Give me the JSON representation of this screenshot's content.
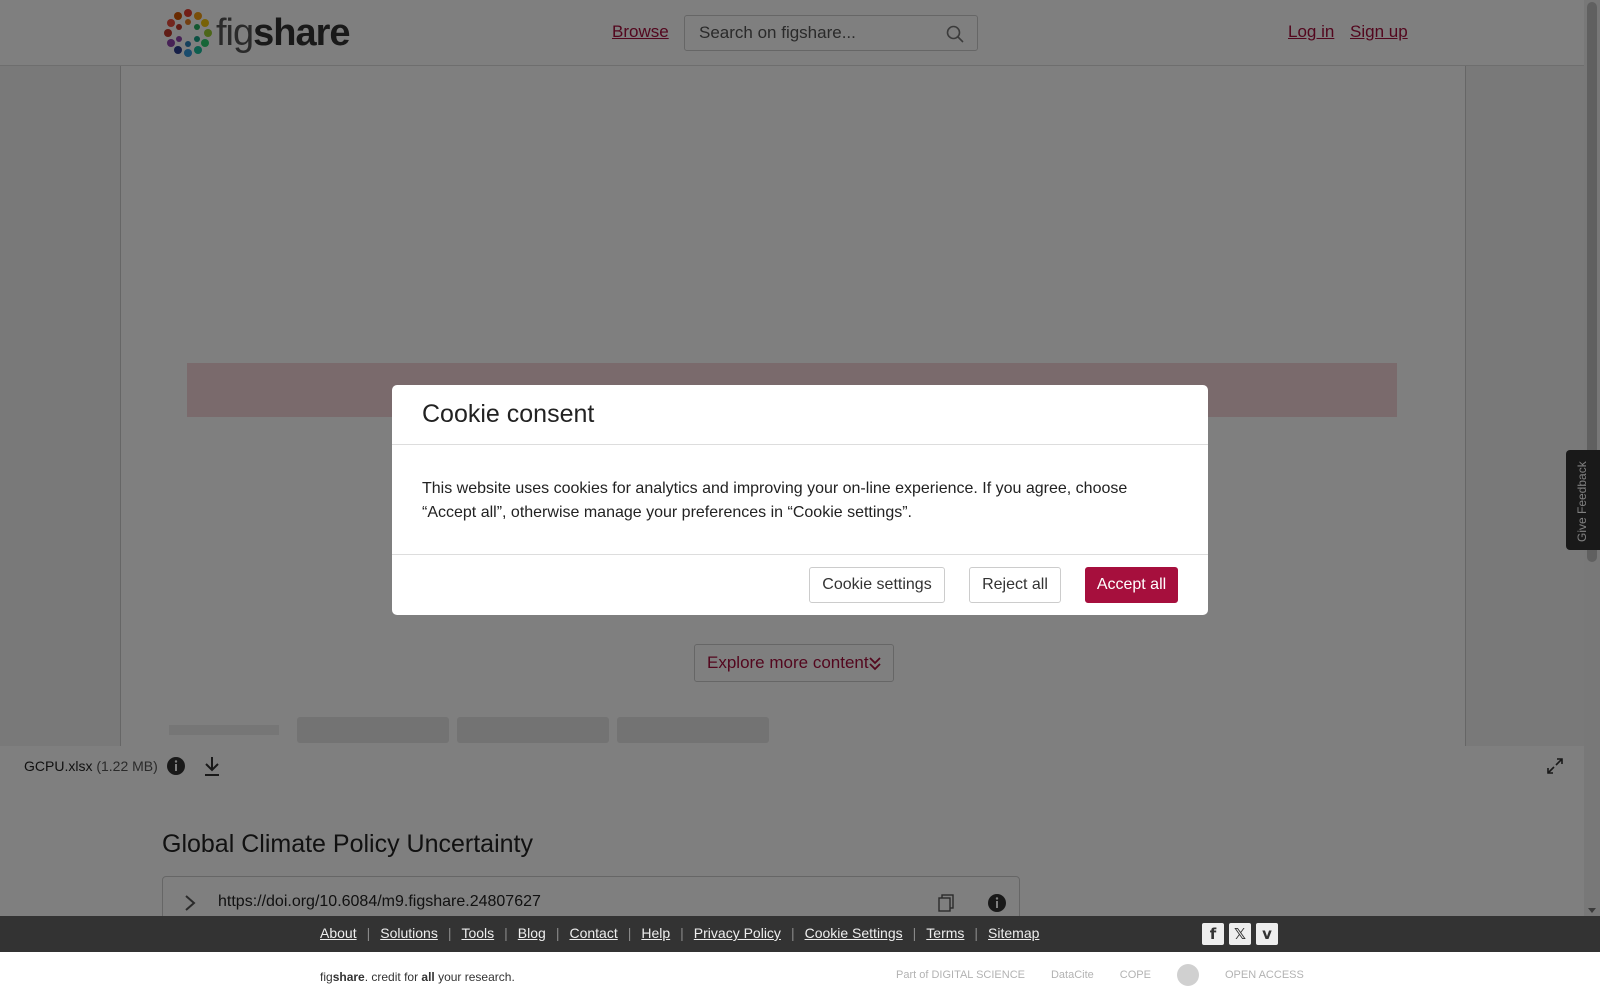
{
  "header": {
    "logo_text_light": "fig",
    "logo_text_bold": "share",
    "browse_label": "Browse",
    "search_placeholder": "Search on figshare...",
    "login_label": "Log in",
    "signup_label": "Sign up"
  },
  "viewer": {
    "explore_label": "Explore more content",
    "file_name": "GCPU.xlsx",
    "file_size": "(1.22 MB)"
  },
  "item": {
    "title": "Global Climate Policy Uncertainty",
    "doi": "https://doi.org/10.6084/m9.figshare.24807627"
  },
  "feedback_label": "Give Feedback",
  "footer": {
    "links": [
      "About",
      "Solutions",
      "Tools",
      "Blog",
      "Contact",
      "Help",
      "Privacy Policy",
      "Cookie Settings",
      "Terms",
      "Sitemap"
    ],
    "socials": [
      "f",
      "𝕏",
      "v"
    ],
    "tagline_fig": "fig",
    "tagline_share": "share",
    "tagline_mid": ". credit for ",
    "tagline_all": "all",
    "tagline_end": " your research.",
    "partners": [
      "Part of DIGITAL SCIENCE",
      "DataCite",
      "COPE",
      "",
      "OPEN ACCESS"
    ]
  },
  "cookie_modal": {
    "title": "Cookie consent",
    "body": "This website uses cookies for analytics and improving your on-line experience. If you agree, choose “Accept all”, otherwise manage your preferences in “Cookie settings”.",
    "settings_label": "Cookie settings",
    "reject_label": "Reject all",
    "accept_label": "Accept all"
  },
  "colors": {
    "brand": "#a60f3d",
    "footer_bg": "#333333"
  }
}
